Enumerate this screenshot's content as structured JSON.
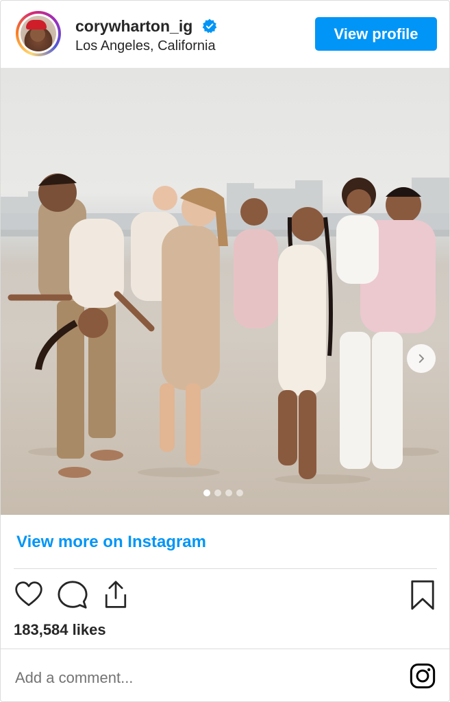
{
  "header": {
    "username": "corywharton_ig",
    "location": "Los Angeles, California",
    "view_profile_label": "View profile",
    "verified_icon": "verified-badge-icon"
  },
  "post": {
    "image_icon": "family-beach-photo",
    "carousel": {
      "slide_count": 4,
      "active_index": 0
    },
    "next_icon": "chevron-right-icon"
  },
  "footer": {
    "view_more_label": "View more on Instagram",
    "likes_text": "183,584 likes",
    "comment_placeholder": "Add a comment...",
    "icons": [
      "heart-icon",
      "comment-icon",
      "share-icon",
      "bookmark-icon",
      "instagram-logo-icon"
    ]
  },
  "colors": {
    "accent": "#0095f6",
    "text": "#262626",
    "muted": "#737373",
    "border": "#dbdbdb"
  }
}
